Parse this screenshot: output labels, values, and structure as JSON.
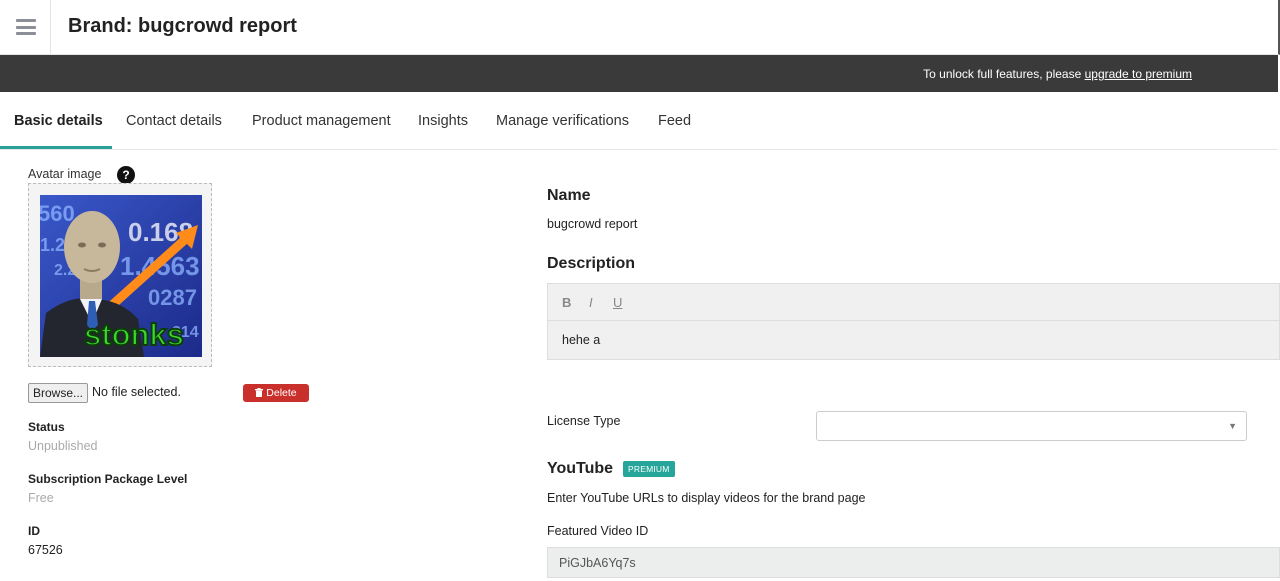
{
  "header": {
    "title": "Brand: bugcrowd report"
  },
  "banner": {
    "text": "To unlock full features, please ",
    "link": "upgrade to premium"
  },
  "tabs": [
    {
      "label": "Basic details",
      "active": true
    },
    {
      "label": "Contact details"
    },
    {
      "label": "Product management"
    },
    {
      "label": "Insights"
    },
    {
      "label": "Manage verifications"
    },
    {
      "label": "Feed"
    }
  ],
  "left": {
    "avatar_label": "Avatar image",
    "help_glyph": "?",
    "avatar_caption": "stonks",
    "avatar_numbers": [
      "560",
      "1.28",
      "2.2",
      "0.168",
      "1.4563",
      "0287",
      "314"
    ],
    "browse_label": "Browse...",
    "file_status": "No file selected.",
    "delete_label": "Delete",
    "status": {
      "label": "Status",
      "value": "Unpublished"
    },
    "subscription": {
      "label": "Subscription Package Level",
      "value": "Free"
    },
    "id": {
      "label": "ID",
      "value": "67526"
    }
  },
  "right": {
    "name": {
      "label": "Name",
      "value": "bugcrowd report"
    },
    "description": {
      "label": "Description",
      "toolbar": [
        "B",
        "I",
        "U"
      ],
      "content": "hehe a"
    },
    "license": {
      "label": "License Type",
      "value": ""
    },
    "youtube": {
      "label": "YouTube",
      "badge": "PREMIUM",
      "help": "Enter YouTube URLs to display videos for the brand page",
      "featured_label": "Featured Video ID",
      "featured_value": "PiGJbA6Yq7s"
    }
  },
  "colors": {
    "accent": "#2aa198",
    "banner_bg": "#3a3a3a",
    "delete": "#c9302c",
    "premium": "#26a69a"
  }
}
